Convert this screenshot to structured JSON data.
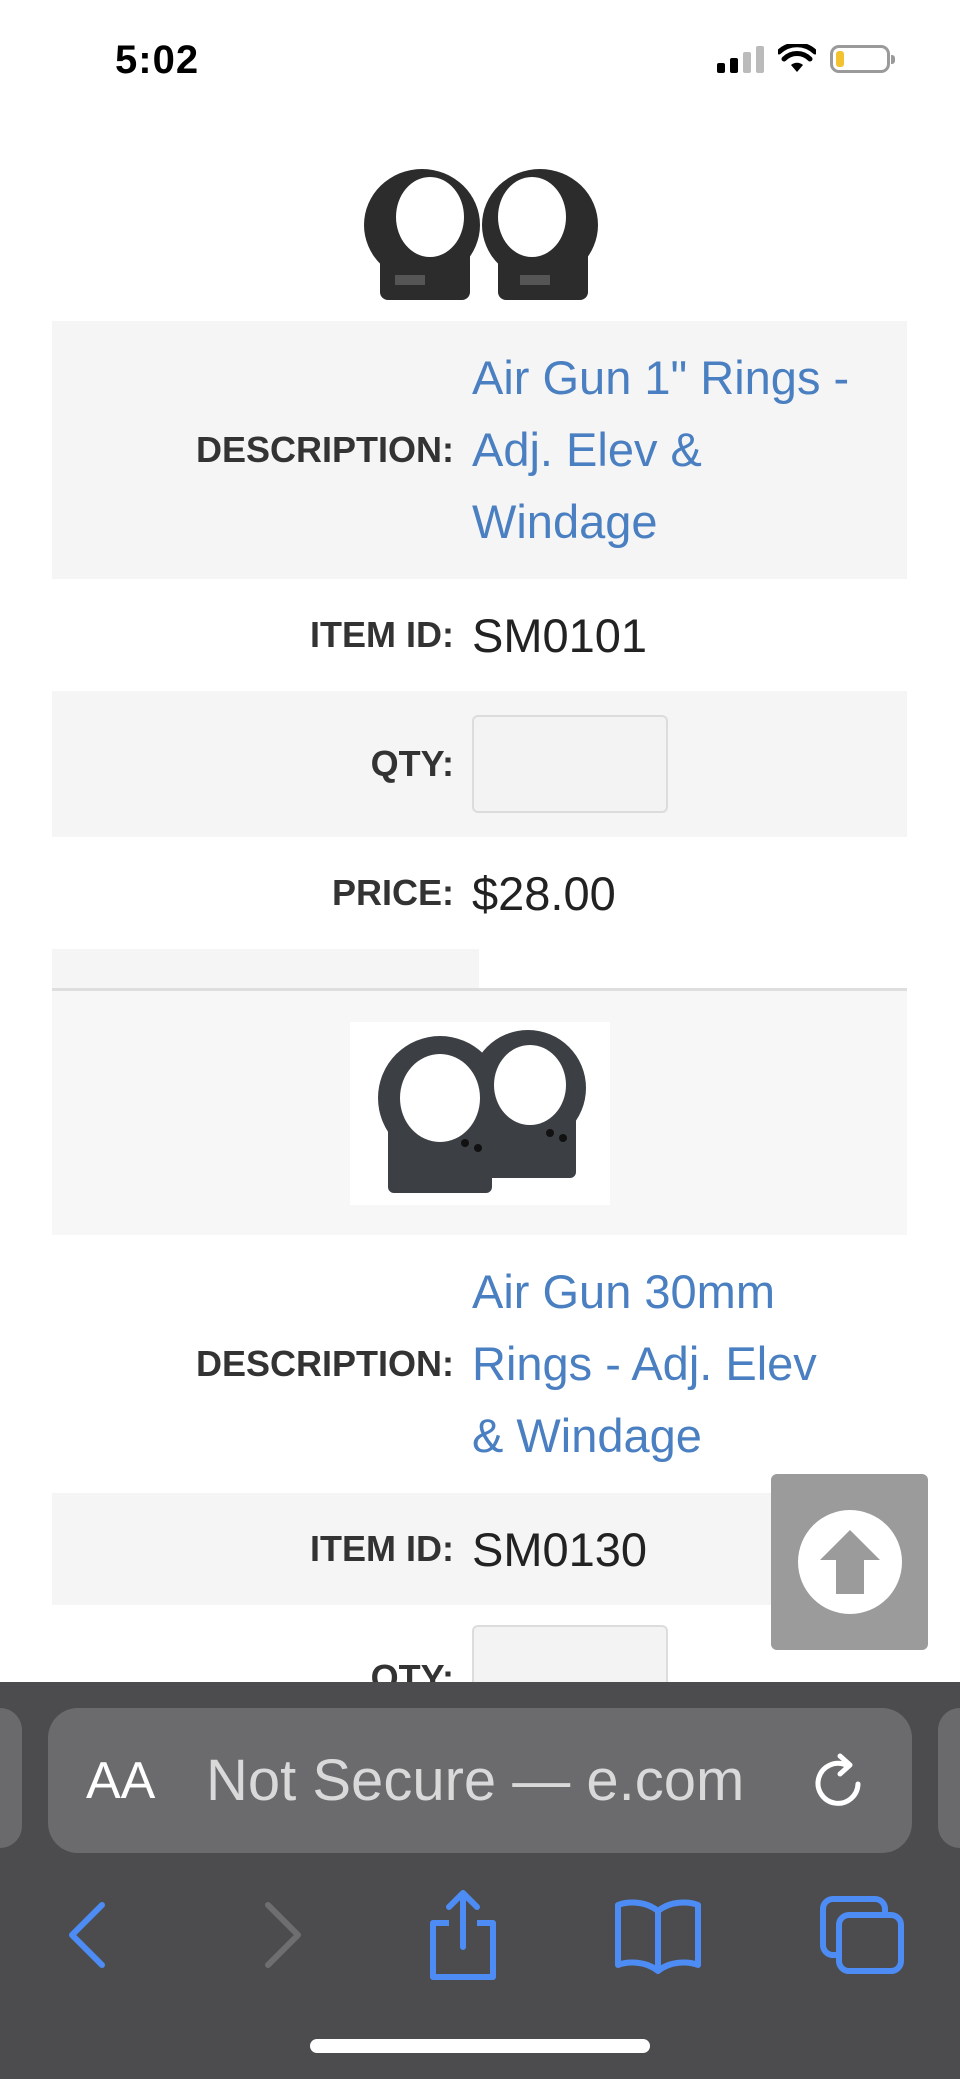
{
  "status": {
    "time": "5:02"
  },
  "products": [
    {
      "description_label": "DESCRIPTION:",
      "description": [
        "Air Gun 1\" Rings -",
        "Adj. Elev &",
        "Windage"
      ],
      "item_id_label": "ITEM ID:",
      "item_id": "SM0101",
      "qty_label": "QTY:",
      "qty_value": "",
      "price_label": "PRICE:",
      "price": "$28.00"
    },
    {
      "description_label": "DESCRIPTION:",
      "description": [
        "Air Gun 30mm",
        "Rings - Adj. Elev",
        "& Windage"
      ],
      "item_id_label": "ITEM ID:",
      "item_id": "SM0130",
      "qty_label": "QTY:",
      "qty_value": ""
    }
  ],
  "browser": {
    "aa_label": "AA",
    "url_text": "Not Secure — ",
    "url_domain": "e.com"
  },
  "colors": {
    "link": "#4a7fc1",
    "toolbar": "#4c4c4e",
    "accent": "#4d8cf5"
  }
}
